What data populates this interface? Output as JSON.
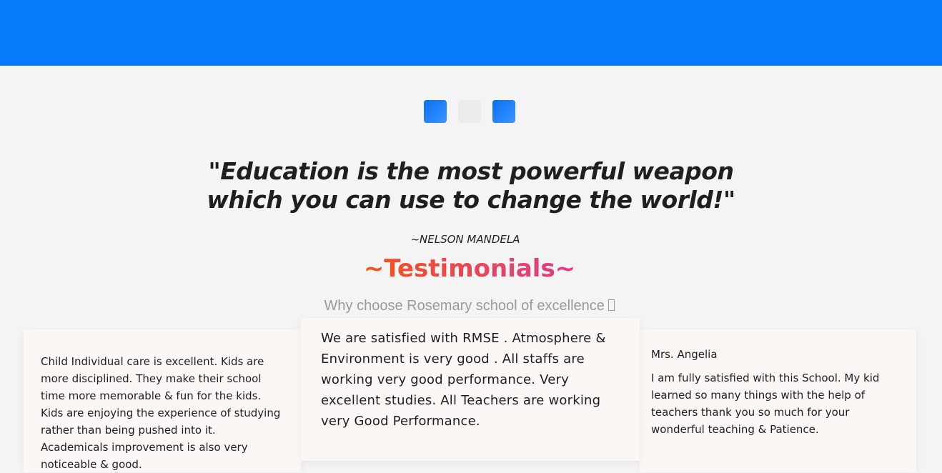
{
  "colors": {
    "topbar": "#087bfc",
    "dot_active": "#1a7ef7",
    "dot_inactive": "#ececec",
    "title_gradient_start": "#f2541b",
    "title_gradient_end": "#e03a8c"
  },
  "carousel_dots": [
    {
      "state": "active"
    },
    {
      "state": "inactive"
    },
    {
      "state": "active"
    }
  ],
  "quote": {
    "line1": "\"Education is the most powerful weapon",
    "line2": "which you can use to change the world!\"",
    "author": "~NELSON MANDELA"
  },
  "testimonials": {
    "title": "~Testimonials~",
    "subtitle": "Why choose Rosemary school of excellence ",
    "subtitle_icon": "question-icon",
    "cards": [
      {
        "name": "",
        "text": "Child Individual care is excellent. Kids are more disciplined. They make their school time more memorable & fun for the kids. Kids are enjoying the experience of studying rather than being pushed into it. Academicals improvement is also very noticeable & good."
      },
      {
        "name": "",
        "text": "We are satisfied with RMSE . Atmosphere & Environment is very good . All staffs are working very good performance. Very excellent studies. All Teachers are working very Good Performance."
      },
      {
        "name": "Mrs. Angelia",
        "text": "I am fully satisfied with this School. My kid learned so many things with the help of teachers thank you so much for your wonderful teaching & Patience."
      }
    ]
  }
}
